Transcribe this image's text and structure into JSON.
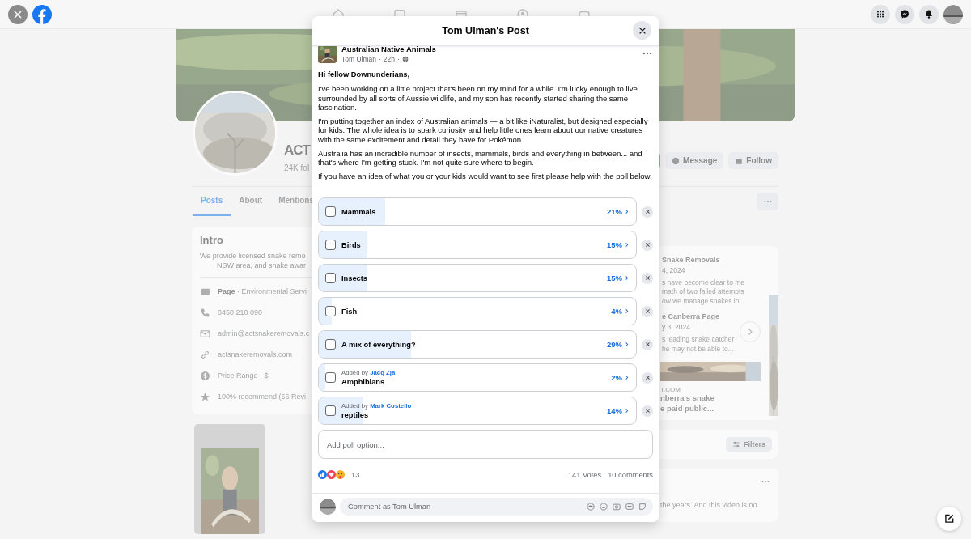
{
  "page": {
    "name": "ACT",
    "followers": "24K fol",
    "buttons": [
      {
        "kind": "primary"
      },
      {
        "kind": "message",
        "label": "Message"
      },
      {
        "kind": "follow",
        "label": "Follow"
      }
    ],
    "tabs": [
      {
        "label": "Posts",
        "selected": true
      },
      {
        "label": "About",
        "selected": false
      },
      {
        "label": "Mentions",
        "selected": false
      }
    ],
    "intro": {
      "title": "Intro",
      "text": "We provide licensed snake remo\nNSW area, and snake awar",
      "items": [
        {
          "kind": "page",
          "text": "**Page** · Environmental Servi"
        },
        {
          "kind": "phone",
          "text": "0450 210 090"
        },
        {
          "kind": "email",
          "text": "admin@actsnakeremovals.c"
        },
        {
          "kind": "link",
          "text": "actsnakeremovals.com"
        },
        {
          "kind": "price",
          "text": "Price Range · $"
        },
        {
          "kind": "rating",
          "text": "100% recommend (56 Revi"
        }
      ]
    },
    "featured": [
      {
        "title": "Snake Removals",
        "date": "4, 2024",
        "text": "s have become clear to me\nmath of two failed attempts\now we manage snakes in..."
      },
      {
        "title": "e Canberra Page",
        "date": "y 3, 2024",
        "text": "s leading snake catcher\nhe may not be able to..."
      }
    ],
    "link_preview": {
      "domain": "T.COM",
      "headline": "nberra's snake\ne paid public..."
    },
    "filters": "Filters",
    "post_snippet": "the years. And this video is no"
  },
  "modal": {
    "title": "Tom Ulman's Post",
    "post": {
      "group": "Australian Native Animals",
      "author": "Tom Ulman",
      "separators": [
        "·",
        "·"
      ],
      "time": "22h",
      "greeting": "Hi fellow Downunderians,",
      "paragraphs": [
        "I've been working on a little project that's been on my mind for a while. I'm lucky enough to live surrounded by all sorts of Aussie wildlife, and my son has recently started sharing the same fascination.",
        "I'm putting together an index of Australian animals — a bit like iNaturalist, but designed especially for kids. The whole idea is to spark curiosity and help little ones learn about our native creatures with the same excitement and detail they have for Pokémon.",
        "Australia has an incredible number of insects, mammals, birds and everything in between... and that's where I'm getting stuck. I'm not quite sure where to begin.",
        "If you have an idea of what you or your kids would want to see first please help with the poll below."
      ]
    },
    "poll": [
      {
        "label": "Mammals",
        "percent": "21%",
        "level": 0.21,
        "checked": false
      },
      {
        "label": "Birds",
        "percent": "15%",
        "level": 0.15,
        "checked": false
      },
      {
        "label": "Insects",
        "percent": "15%",
        "level": 0.15,
        "checked": false
      },
      {
        "label": "Fish",
        "percent": "4%",
        "level": 0.04,
        "checked": false
      },
      {
        "label": "A mix of everything?",
        "percent": "29%",
        "level": 0.29,
        "checked": false
      },
      {
        "label": "Amphibians",
        "percent": "2%",
        "level": 0.02,
        "checked": false,
        "added_by": {
          "prefix": "Added by",
          "name": "Jacq Zja"
        }
      },
      {
        "label": "reptiles",
        "percent": "14%",
        "level": 0.14,
        "checked": false,
        "added_by": {
          "prefix": "Added by",
          "name": "Mark Costello"
        }
      }
    ],
    "add_option": {
      "placeholder": "Add poll option..."
    },
    "reactions": "13",
    "votes": "141 Votes",
    "comments": "10 comments",
    "comment": {
      "placeholder": "Comment as Tom Ulman"
    }
  }
}
